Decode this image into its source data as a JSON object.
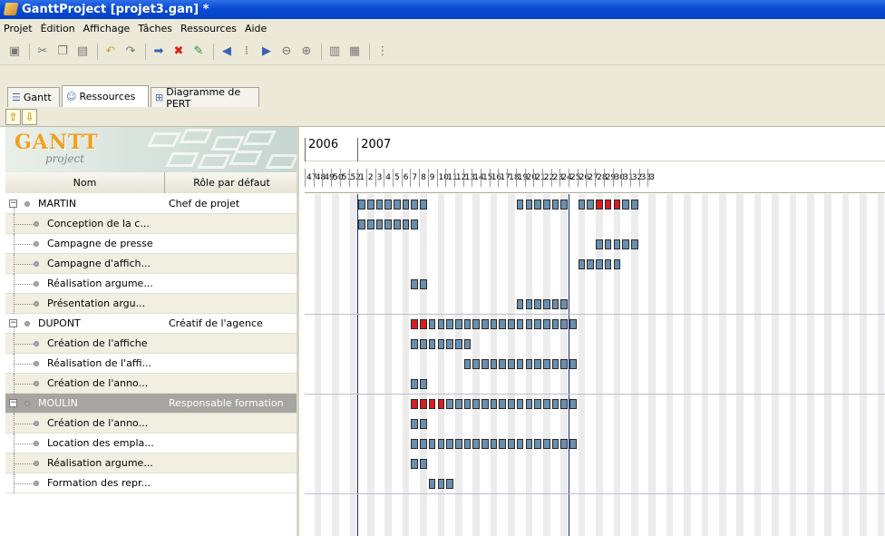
{
  "window": {
    "title": "GanttProject [projet3.gan] *"
  },
  "menu": [
    "Projet",
    "Édition",
    "Affichage",
    "Tâches",
    "Ressources",
    "Aide"
  ],
  "tabs": [
    {
      "label": "Gantt",
      "icon": "gantt-icon"
    },
    {
      "label": "Ressources",
      "icon": "resources-icon"
    },
    {
      "label": "Diagramme de PERT",
      "icon": "pert-icon"
    }
  ],
  "logo": {
    "text": "GANTT",
    "sub": "project"
  },
  "table": {
    "col_name": "Nom",
    "col_role": "Rôle par défaut"
  },
  "rows": [
    {
      "name": "MARTIN",
      "role": "Chef de projet",
      "level": 0
    },
    {
      "name": "Conception de la c...",
      "role": "",
      "level": 1
    },
    {
      "name": "Campagne de presse",
      "role": "",
      "level": 1
    },
    {
      "name": "Campagne d'affich...",
      "role": "",
      "level": 1
    },
    {
      "name": "Réalisation argume...",
      "role": "",
      "level": 1
    },
    {
      "name": "Présentation argu...",
      "role": "",
      "level": 1
    },
    {
      "name": "DUPONT",
      "role": "Créatif de l'agence",
      "level": 0
    },
    {
      "name": "Création de l'affiche",
      "role": "",
      "level": 1
    },
    {
      "name": "Réalisation de l'affi...",
      "role": "",
      "level": 1
    },
    {
      "name": "Création de l'anno...",
      "role": "",
      "level": 1
    },
    {
      "name": "MOULIN",
      "role": "Responsable formation",
      "level": 0,
      "selected": true
    },
    {
      "name": "Création de l'anno...",
      "role": "",
      "level": 1
    },
    {
      "name": "Location des empla...",
      "role": "",
      "level": 1
    },
    {
      "name": "Réalisation argume...",
      "role": "",
      "level": 1
    },
    {
      "name": "Formation des repr...",
      "role": "",
      "level": 1
    }
  ],
  "timeline": {
    "years": [
      "2006",
      "2007"
    ],
    "weeks": [
      "47",
      "48",
      "49",
      "50",
      "51",
      "52",
      "1",
      "2",
      "3",
      "4",
      "5",
      "6",
      "7",
      "8",
      "9",
      "10",
      "11",
      "12",
      "13",
      "14",
      "15",
      "16",
      "17",
      "18",
      "19",
      "20",
      "21",
      "22",
      "23",
      "24",
      "25",
      "26",
      "27",
      "28",
      "29",
      "30",
      "31",
      "32",
      "33",
      "3"
    ]
  },
  "bars": [
    {
      "row": 0,
      "start": 6,
      "end": 13,
      "over": []
    },
    {
      "row": 0,
      "start": 24,
      "end": 29,
      "over": []
    },
    {
      "row": 0,
      "start": 31,
      "end": 37,
      "over": [
        33,
        34,
        35
      ]
    },
    {
      "row": 1,
      "start": 6,
      "end": 12,
      "over": []
    },
    {
      "row": 2,
      "start": 33,
      "end": 37,
      "over": []
    },
    {
      "row": 3,
      "start": 31,
      "end": 35,
      "over": []
    },
    {
      "row": 4,
      "start": 12,
      "end": 13,
      "over": []
    },
    {
      "row": 5,
      "start": 24,
      "end": 29,
      "over": []
    },
    {
      "row": 6,
      "start": 12,
      "end": 30,
      "over": [
        12,
        13
      ]
    },
    {
      "row": 7,
      "start": 12,
      "end": 18,
      "over": []
    },
    {
      "row": 8,
      "start": 18,
      "end": 30,
      "over": []
    },
    {
      "row": 9,
      "start": 12,
      "end": 13,
      "over": []
    },
    {
      "row": 10,
      "start": 12,
      "end": 30,
      "over": [
        12,
        13,
        14,
        15
      ]
    },
    {
      "row": 11,
      "start": 12,
      "end": 13,
      "over": []
    },
    {
      "row": 12,
      "start": 12,
      "end": 30,
      "over": []
    },
    {
      "row": 13,
      "start": 12,
      "end": 13,
      "over": []
    },
    {
      "row": 14,
      "start": 14,
      "end": 16,
      "over": []
    }
  ],
  "colors": {
    "bar": "#6a8fae",
    "overload": "#d42020",
    "selected_row": "#a7a5a0"
  }
}
